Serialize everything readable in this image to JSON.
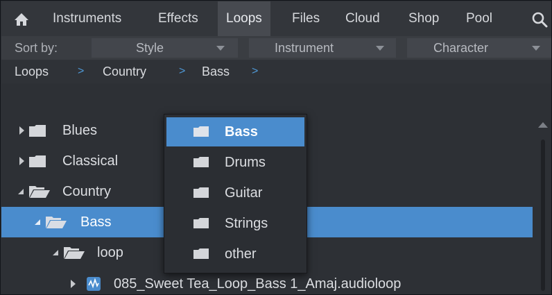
{
  "nav": {
    "tabs": [
      {
        "label": "Instruments"
      },
      {
        "label": "Effects"
      },
      {
        "label": "Loops"
      },
      {
        "label": "Files"
      },
      {
        "label": "Cloud"
      },
      {
        "label": "Shop"
      },
      {
        "label": "Pool"
      }
    ],
    "active_tab": "Loops",
    "icons": {
      "home": "home-icon",
      "search": "search-icon"
    }
  },
  "sort": {
    "label": "Sort by:",
    "options": [
      {
        "label": "Style"
      },
      {
        "label": "Instrument"
      },
      {
        "label": "Character"
      }
    ]
  },
  "breadcrumb": {
    "items": [
      {
        "label": "Loops"
      },
      {
        "label": "Country"
      },
      {
        "label": "Bass"
      }
    ],
    "separator": ">"
  },
  "tree": {
    "rows": [
      {
        "label": "Blues",
        "expanded": false,
        "selected": false
      },
      {
        "label": "Classical",
        "expanded": false,
        "selected": false
      },
      {
        "label": "Country",
        "expanded": true,
        "selected": false
      },
      {
        "label": "Bass",
        "expanded": true,
        "selected": true
      },
      {
        "label": "loop",
        "expanded": true,
        "selected": false
      },
      {
        "label": "085_Sweet Tea_Loop_Bass 1_Amaj.audioloop",
        "expanded": false,
        "selected": false
      }
    ]
  },
  "popup": {
    "items": [
      {
        "label": "Bass",
        "selected": true
      },
      {
        "label": "Drums",
        "selected": false
      },
      {
        "label": "Guitar",
        "selected": false
      },
      {
        "label": "Strings",
        "selected": false
      },
      {
        "label": "other",
        "selected": false
      }
    ]
  },
  "colors": {
    "accent": "#4a8ccd",
    "background": "#2d3035",
    "separator": "#4f9ad8"
  }
}
